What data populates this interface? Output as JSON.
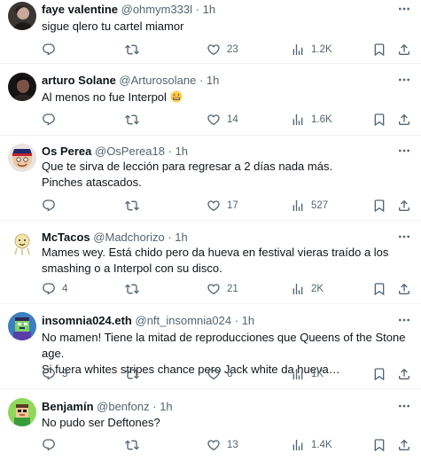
{
  "tweets": [
    {
      "name": "faye valentine",
      "handle": "@ohmym333l",
      "time": "1h",
      "text": "sigue qlero tu cartel miamor",
      "replies": "",
      "retweets": "",
      "likes": "23",
      "views": "1.2K"
    },
    {
      "name": "arturo Solane",
      "handle": "@Arturosolane",
      "time": "1h",
      "text": "Al menos no fue Interpol",
      "emoji": "grimacing-face",
      "replies": "",
      "retweets": "",
      "likes": "14",
      "views": "1.6K"
    },
    {
      "name": "Os Perea",
      "handle": "@OsPerea18",
      "time": "1h",
      "text": "Que te sirva de lección para regresar a 2 días nada más.",
      "text2": "Pinches atascados.",
      "replies": "",
      "retweets": "",
      "likes": "17",
      "views": "527"
    },
    {
      "name": "McTacos",
      "handle": "@Madchorizo",
      "time": "1h",
      "text": "Mames wey. Está chido pero da hueva en festival vieras traído a los",
      "text2": "smashing o a Interpol con su disco.",
      "replies": "4",
      "retweets": "",
      "likes": "21",
      "views": "2K"
    },
    {
      "name": "insomnia024.eth",
      "handle": "@nft_insomnia024",
      "time": "1h",
      "text": "No mamen! Tiene la mitad de reproducciones que Queens of the Stone age.",
      "text2": "Si fuera whites stripes chance pero Jack white da hueva…",
      "replies": "3",
      "retweets": "",
      "likes": "6",
      "views": "1K"
    },
    {
      "name": "Benjamín",
      "handle": "@benfonz",
      "time": "1h",
      "text": "No pudo ser Deftones?",
      "replies": "",
      "retweets": "",
      "likes": "13",
      "views": "1.4K"
    }
  ],
  "separator": "·",
  "icons": {
    "reply": "reply-icon",
    "retweet": "retweet-icon",
    "like": "heart-icon",
    "views": "views-icon",
    "bookmark": "bookmark-icon",
    "share": "share-icon",
    "more": "more-icon"
  },
  "colors": {
    "text": "#0f1419",
    "secondary": "#536471",
    "divider": "#eff3f4"
  }
}
